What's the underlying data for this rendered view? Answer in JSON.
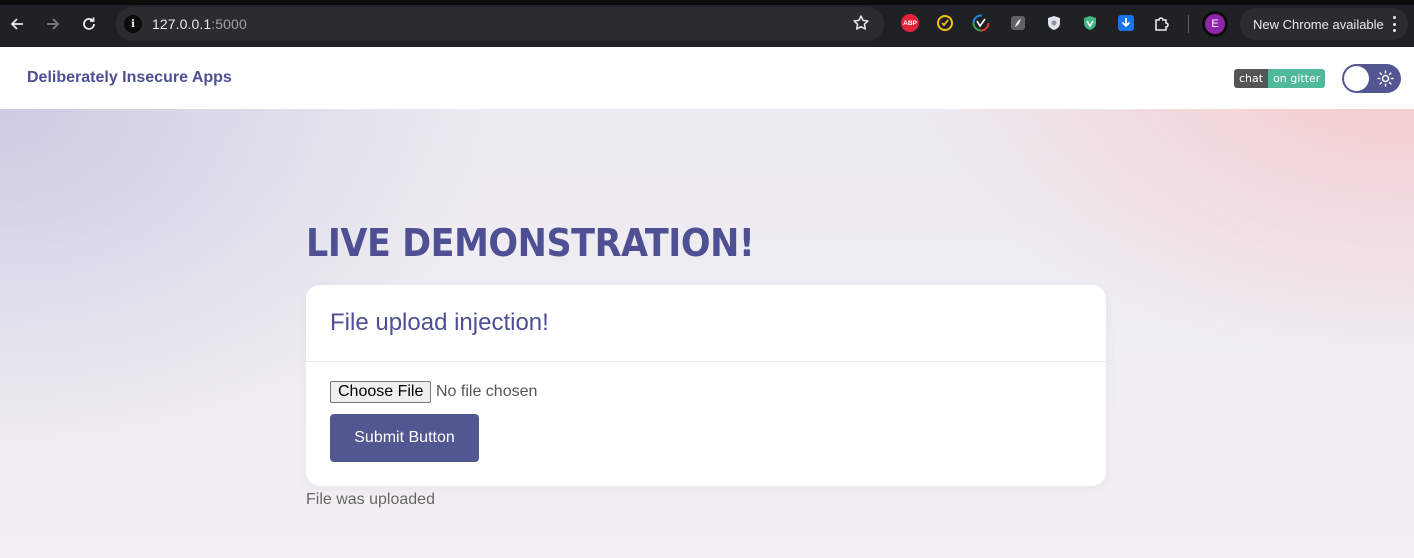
{
  "browser": {
    "url_host": "127.0.0.1",
    "url_port": ":5000",
    "profile_initial": "E",
    "update_label": "New Chrome available",
    "extensions": [
      {
        "name": "adblock-plus-icon",
        "label": "ABP"
      },
      {
        "name": "norton-icon"
      },
      {
        "name": "colorful-extension-icon"
      },
      {
        "name": "feather-extension-icon"
      },
      {
        "name": "shield-extension-icon"
      },
      {
        "name": "vue-devtools-icon"
      },
      {
        "name": "download-extension-icon"
      },
      {
        "name": "extensions-puzzle-icon"
      }
    ],
    "colors": {
      "toolbar": "#202124",
      "omnibox": "#2b2c2f",
      "avatar": "#8e24aa"
    }
  },
  "header": {
    "brand": "Deliberately Insecure Apps",
    "badge_left": "chat",
    "badge_right": "on gitter",
    "theme_toggle_icon": "sun-icon"
  },
  "main": {
    "heading": "LIVE DEMONSTRATION!",
    "card_title": "File upload injection!",
    "file_button": "Choose File",
    "file_status": "No file chosen",
    "submit_label": "Submit Button",
    "result": "File was uploaded"
  },
  "colors": {
    "accent": "#525691",
    "brand_text": "#4e5093",
    "badge_green": "#4fb999",
    "badge_grey": "#555555"
  }
}
